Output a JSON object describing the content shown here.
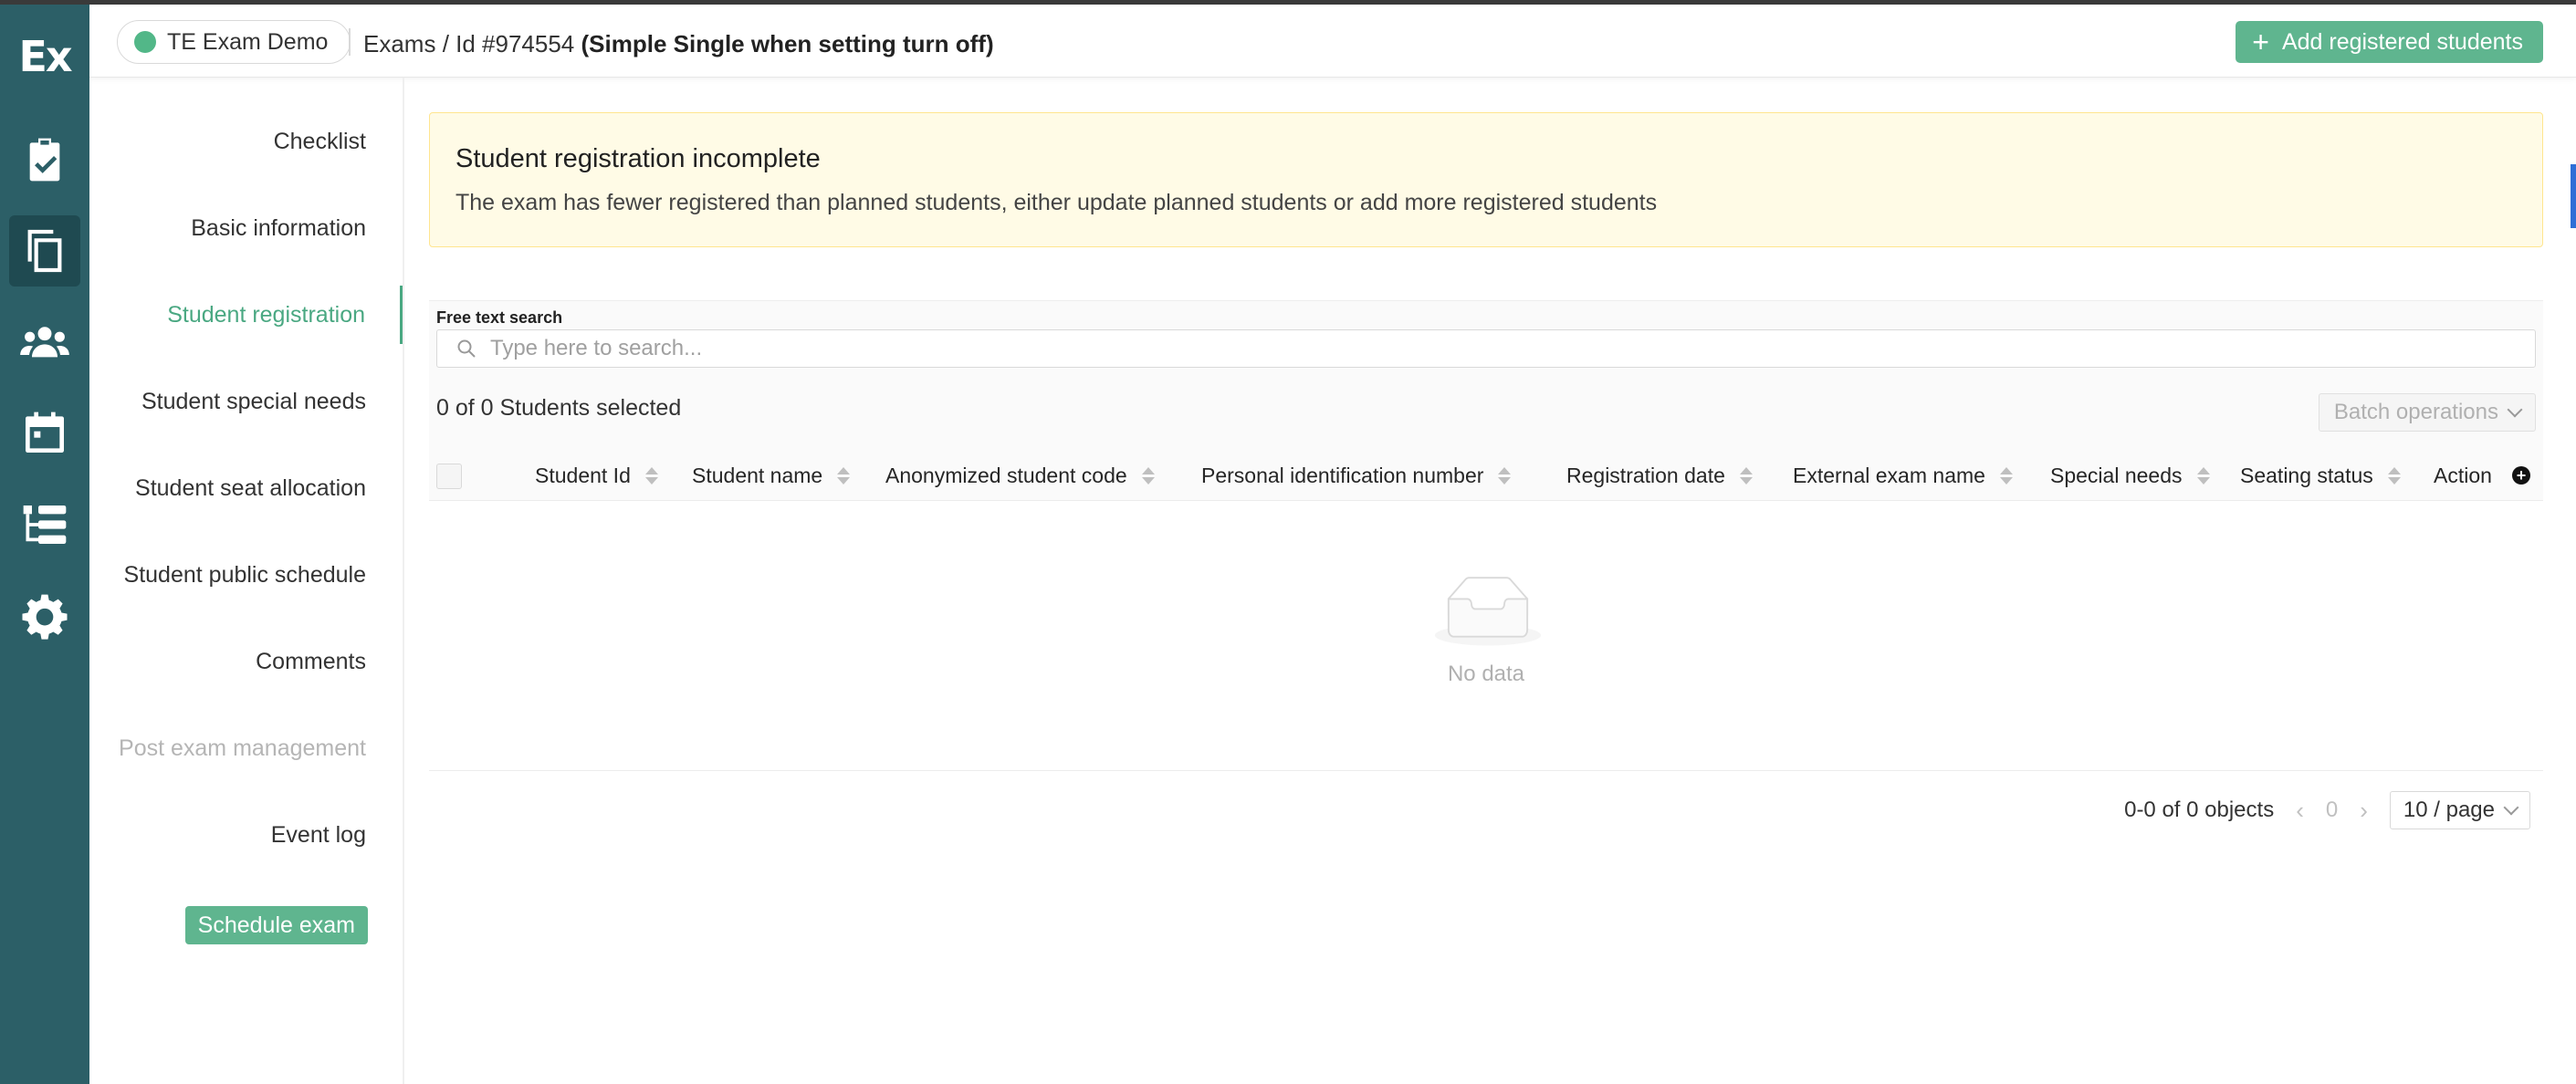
{
  "rail": {
    "logo": "Ex",
    "icons": [
      "clipboard-check-icon",
      "copy-icon",
      "users-icon",
      "calendar-icon",
      "hierarchy-list-icon",
      "gear-icon"
    ]
  },
  "header": {
    "org": "TE Exam Demo",
    "breadcrumb_link": "Exams",
    "breadcrumb_id": " / Id #974554 ",
    "breadcrumb_title": "(Simple Single when setting turn off)",
    "add_button": "Add registered students"
  },
  "sidenav": {
    "items": [
      {
        "label": "Checklist"
      },
      {
        "label": "Basic information"
      },
      {
        "label": "Student registration"
      },
      {
        "label": "Student special needs"
      },
      {
        "label": "Student seat allocation"
      },
      {
        "label": "Student public schedule"
      },
      {
        "label": "Comments"
      },
      {
        "label": "Post exam management"
      },
      {
        "label": "Event log"
      }
    ],
    "schedule_button": "Schedule exam"
  },
  "alert": {
    "title": "Student registration incomplete",
    "text": "The exam has fewer registered than planned students, either update planned students or add more registered students"
  },
  "filter": {
    "label": "Free text search",
    "placeholder": "Type here to search..."
  },
  "table": {
    "selected_text": "0 of 0 Students selected",
    "batch_label": "Batch operations",
    "columns": [
      "Student Id",
      "Student name",
      "Anonymized student code",
      "Personal identification number",
      "Registration date",
      "External exam name",
      "Special needs",
      "Seating status",
      "Action"
    ],
    "empty_text": "No data"
  },
  "pagination": {
    "summary": "0-0 of 0 objects",
    "current_page": "0",
    "page_size": "10 / page"
  },
  "colors": {
    "rail": "#2c5f67",
    "accent": "#4aa882",
    "button": "#5fb58f",
    "alert_bg": "#fffbe6"
  }
}
